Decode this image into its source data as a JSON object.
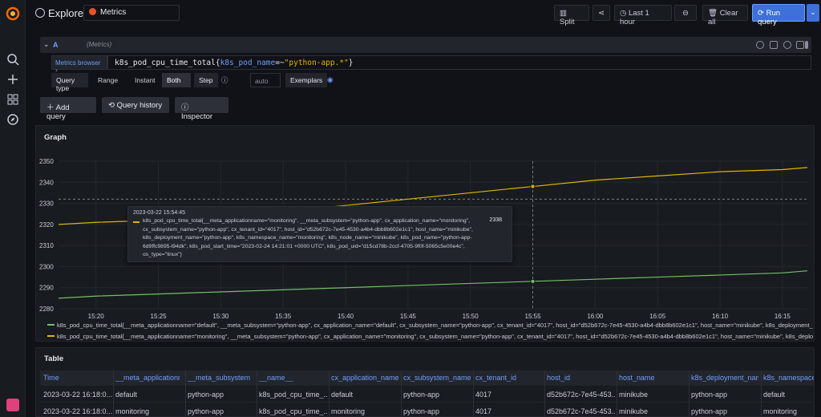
{
  "header": {
    "title": "Explore",
    "datasource": "Metrics",
    "split_label": "Split",
    "time_range": "Last 1 hour",
    "clear_all": "Clear all",
    "run_query": "Run query"
  },
  "query": {
    "ref": "A",
    "datasource_hint": "(Metrics)",
    "metrics_browser": "Metrics browser",
    "expr_metric": "k8s_pod_cpu_time_total",
    "expr_open": "{",
    "expr_label": "k8s_pod_name",
    "expr_op": "=~",
    "expr_value": "\"python-app.*\"",
    "expr_close": "}",
    "query_type_label": "Query type",
    "types": [
      "Range",
      "Instant",
      "Both"
    ],
    "step_label": "Step",
    "step_placeholder": "auto",
    "exemplars_label": "Exemplars"
  },
  "actions": {
    "add_query": "Add query",
    "query_history": "Query history",
    "inspector": "Inspector"
  },
  "colors": {
    "series_default": "#73bf69",
    "series_monitoring": "#e0b400",
    "accent": "#3d71d9"
  },
  "graph": {
    "title": "Graph",
    "tooltip": {
      "time": "2023-03-22 15:54:45",
      "label": "k8s_pod_cpu_time_total{__meta_applicationname=\"monitoring\", __meta_subsystem=\"python-app\", cx_application_name=\"monitoring\", cx_subsystem_name=\"python-app\", cx_tenant_id=\"4017\", host_id=\"d52b672c-7e45-4530-a4b4-dbb8b602e1c1\", host_name=\"minikube\", k8s_deployment_name=\"python-app\", k8s_namespace_name=\"monitoring\", k8s_node_name=\"minikube\", k8s_pod_name=\"python-app-6d9ffc9895-l94dk\", k8s_pod_start_time=\"2023-02-24 14:21:01 +0000 UTC\", k8s_pod_uid=\"d15cd78b-2ccf-4705-9f0f-5065c5e00e4c\", os_type=\"linux\"}",
      "value": "2338"
    },
    "legend": [
      "k8s_pod_cpu_time_total{__meta_applicationname=\"default\", __meta_subsystem=\"python-app\", cx_application_name=\"default\", cx_subsystem_name=\"python-app\", cx_tenant_id=\"4017\", host_id=\"d52b672c-7e45-4530-a4b4-dbb8b602e1c1\", host_name=\"minikube\", k8s_deployment_name=\"pyth",
      "k8s_pod_cpu_time_total{__meta_applicationname=\"monitoring\", __meta_subsystem=\"python-app\", cx_application_name=\"monitoring\", cx_subsystem_name=\"python-app\", cx_tenant_id=\"4017\", host_id=\"d52b672c-7e45-4530-a4b4-dbb8b602e1c1\", host_name=\"minikube\", k8s_deployment_name=\"python-"
    ]
  },
  "chart_data": {
    "type": "line",
    "title": "",
    "xlabel": "",
    "ylabel": "",
    "x": [
      "15:17",
      "15:20",
      "15:25",
      "15:30",
      "15:35",
      "15:40",
      "15:45",
      "15:50",
      "15:55",
      "16:00",
      "16:05",
      "16:10",
      "16:15",
      "16:17"
    ],
    "xticks": [
      "15:20",
      "15:25",
      "15:30",
      "15:35",
      "15:40",
      "15:45",
      "15:50",
      "15:55",
      "16:00",
      "16:05",
      "16:10",
      "16:15"
    ],
    "ylim": [
      2280,
      2350
    ],
    "yticks": [
      2280,
      2290,
      2300,
      2310,
      2320,
      2330,
      2340,
      2350
    ],
    "series": [
      {
        "values": [
          2285,
          2286,
          2287,
          2288,
          2289,
          2290,
          2291,
          2292,
          2293,
          2294,
          2295,
          2296,
          2297,
          2298
        ]
      },
      {
        "values": [
          2320,
          2321,
          2322,
          2324,
          2326,
          2329,
          2332,
          2335,
          2338,
          2341,
          2343,
          2345,
          2346,
          2347
        ]
      }
    ],
    "hover_x": "15:55",
    "threshold_y": 2332,
    "grid": true
  },
  "table": {
    "title": "Table",
    "columns": [
      "Time",
      "__meta_applicationname",
      "__meta_subsystem",
      "__name__",
      "cx_application_name",
      "cx_subsystem_name",
      "cx_tenant_id",
      "host_id",
      "host_name",
      "k8s_deployment_name",
      "k8s_namespace_n"
    ],
    "rows": [
      [
        "2023-03-22 16:18:0...",
        "default",
        "python-app",
        "k8s_pod_cpu_time_...",
        "default",
        "python-app",
        "4017",
        "d52b672c-7e45-453...",
        "minikube",
        "python-app",
        "default"
      ],
      [
        "2023-03-22 16:18:0...",
        "monitoring",
        "python-app",
        "k8s_pod_cpu_time_...",
        "monitoring",
        "python-app",
        "4017",
        "d52b672c-7e45-453...",
        "minikube",
        "python-app",
        "monitoring"
      ]
    ]
  }
}
